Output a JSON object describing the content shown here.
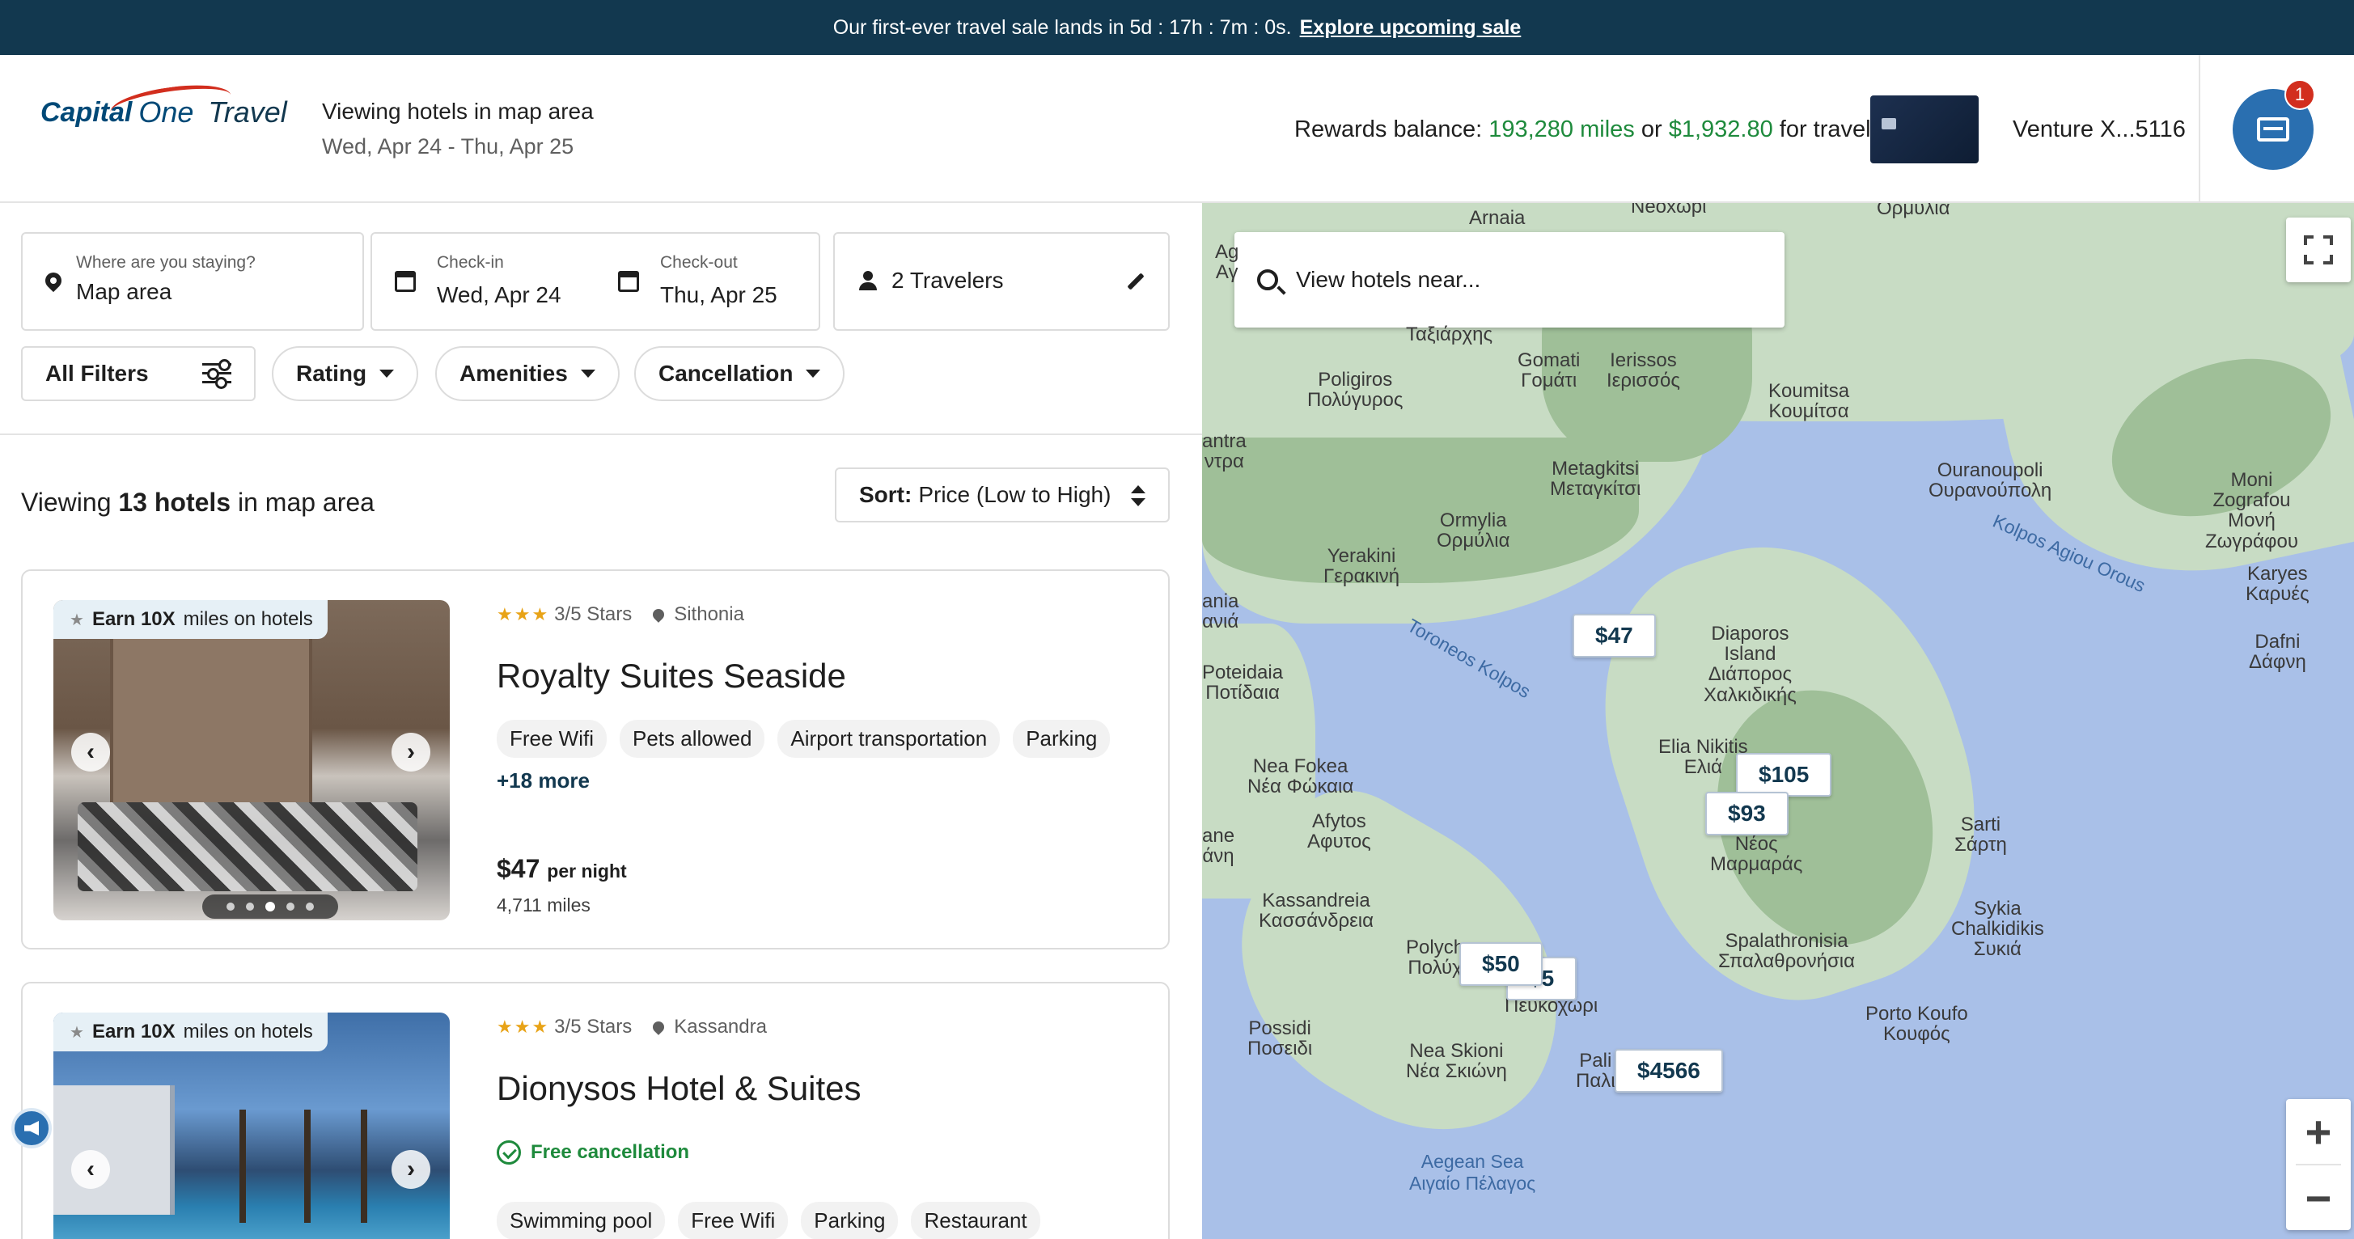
{
  "banner": {
    "text": "Our first-ever travel sale lands in 5d : 17h : 7m : 0s.",
    "link": "Explore upcoming sale"
  },
  "header": {
    "logo_capital": "Capital",
    "logo_one": "One",
    "logo_travel": "Travel",
    "context_title": "Viewing hotels in map area",
    "context_dates": "Wed, Apr 24 - Thu, Apr 25",
    "rewards_prefix": "Rewards balance:",
    "rewards_miles": "193,280 miles",
    "rewards_or": "or",
    "rewards_cash": "$1,932.80",
    "rewards_suffix": "for travel",
    "card_name": "Venture X...5116",
    "notifications": "1"
  },
  "search": {
    "where_label": "Where are you staying?",
    "where_value": "Map area",
    "checkin_label": "Check-in",
    "checkin_value": "Wed, Apr 24",
    "checkout_label": "Check-out",
    "checkout_value": "Thu, Apr 25",
    "travelers": "2 Travelers"
  },
  "filters": {
    "all": "All Filters",
    "rating": "Rating",
    "amenities": "Amenities",
    "cancellation": "Cancellation"
  },
  "results": {
    "prefix": "Viewing",
    "count": "13 hotels",
    "suffix": "in map area",
    "sort_label": "Sort:",
    "sort_value": "Price (Low to High)"
  },
  "hotels": [
    {
      "earn_bold": "Earn 10X",
      "earn_rest": "miles on hotels",
      "stars": "★★★",
      "rating": "3/5 Stars",
      "location": "Sithonia",
      "name": "Royalty Suites Seaside",
      "amenities": [
        "Free Wifi",
        "Pets allowed",
        "Airport transportation",
        "Parking"
      ],
      "more": "+18 more",
      "price": "$47",
      "price_unit": "per night",
      "miles": "4,711 miles"
    },
    {
      "earn_bold": "Earn 10X",
      "earn_rest": "miles on hotels",
      "stars": "★★★",
      "rating": "3/5 Stars",
      "location": "Kassandra",
      "name": "Dionysos Hotel & Suites",
      "free_cancellation": "Free cancellation",
      "amenities": [
        "Swimming pool",
        "Free Wifi",
        "Parking",
        "Restaurant"
      ]
    }
  ],
  "map": {
    "search_placeholder": "View hotels near...",
    "labels": {
      "arnaia": "Arnaia",
      "neoxori": "Neoxωpι",
      "ormylia_top": "Ορμύλια",
      "taxiarchis": "Ταξιάρχης",
      "poligiros": "Poligiros\nΠολύγυρος",
      "gomati": "Gomati\nΓομάτι",
      "ierissos": "Ierissos\nΙερισσός",
      "koumitsa": "Koumitsa\nΚουμίτσα",
      "ouranoupoli": "Ouranoupoli\nΟυρανούπολη",
      "moni": "Moni\nZografou\nΜονή\nΖωγράφου",
      "metagkitsi": "Metagkitsi\nΜεταγκίτσι",
      "ormylia": "Ormylia\nΟρμύλια",
      "yerakini": "Yerakini\nΓερακινή",
      "karyes": "Karyes\nΚαρυές",
      "dafni": "Dafni\nΔάφνη",
      "diaporos": "Diaporos\nIsland\nΔιάπορος\nΧαλκιδικής",
      "poteidaia": "Poteidaia\nΠοτίδαια",
      "elia": "Elia Nikitis\nΕλιά",
      "nea_fokea": "Nea Fokea\nΝέα Φώκαια",
      "afytos": "Afytos\nΑφυτος",
      "neos_marmaras": "Νέος\nΜαρμαράς",
      "sarti": "Sarti\nΣάρτη",
      "kassandreia": "Kassandreia\nΚασσάνδρεια",
      "sykia": "Sykia\nChalkidikis\nΣυκιά",
      "spalathronisia": "Spalathronisia\nΣπαλαθρονήσια",
      "polychrono": "Polych\nΠολύχ",
      "pefkochori": "Πευκοχώρι",
      "porto_koufo": "Porto Koufo\nΚουφός",
      "possidi": "Possidi\nΠοσειδι",
      "nea_skioni": "Nea Skioni\nΝέα Σκιώνη",
      "paliouri": "Pali\nΠαλι",
      "aegean": "Aegean Sea\nΑιγαίο Πέλαγος",
      "kolpos_agiou_orous": "Kolpos Agiou Orous",
      "toroneos_kolpos": "Toroneos Kolpos",
      "ania": "ania\nανιά",
      "antra": "antra\nντρα",
      "ane": "ane\nάνη",
      "ag": "Ag\nΑγ"
    },
    "pins": [
      "$47",
      "$105",
      "$93",
      "$50",
      "$4566",
      "$5"
    ]
  },
  "colors": {
    "banner_bg": "#12384f",
    "accent_green": "#1e8a3c",
    "brand_blue": "#12384f",
    "notification_red": "#d22e1e",
    "map_water": "#a9c0e8",
    "map_land": "#c8dcc4"
  }
}
